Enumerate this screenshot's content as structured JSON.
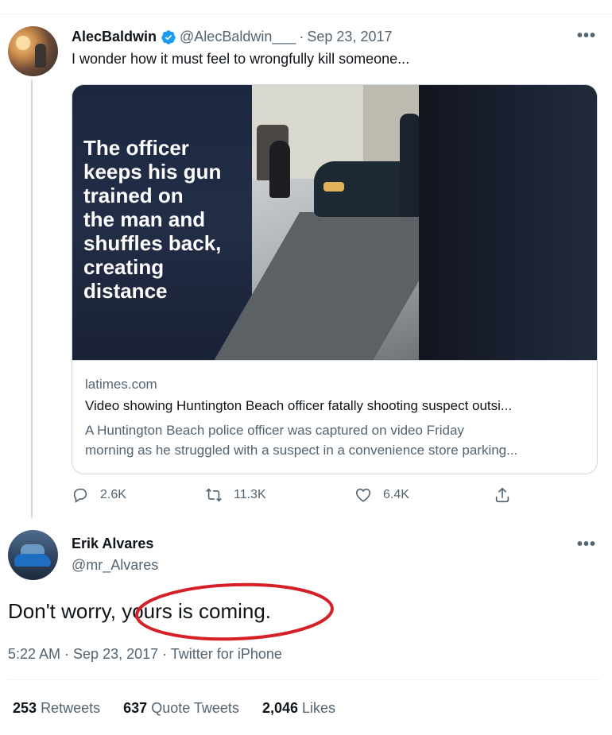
{
  "original_tweet": {
    "display_name": "AlecBaldwin",
    "handle": "@AlecBaldwin___",
    "separator": "·",
    "date": "Sep 23, 2017",
    "more_icon": "•••",
    "text": "I wonder how it must feel to wrongfully kill someone...",
    "card": {
      "overlay_text": "The officer\nkeeps his gun\ntrained on\nthe man and\nshuffles back,\ncreating\ndistance",
      "domain": "latimes.com",
      "title": "Video showing Huntington Beach officer fatally shooting suspect outsi...",
      "description_line1": "A Huntington Beach police officer was captured on video Friday",
      "description_line2": "morning as he struggled with a suspect in a convenience store parking..."
    },
    "actions": {
      "reply_count": "2.6K",
      "retweet_count": "11.3K",
      "like_count": "6.4K"
    }
  },
  "reply_tweet": {
    "display_name": "Erik Alvares",
    "handle": "@mr_Alvares",
    "more_icon": "•••",
    "text_before": "Don't worry, ",
    "text_highlight": "yours is coming.",
    "timestamp": "5:22 AM · Sep 23, 2017 · Twitter for iPhone",
    "stats": {
      "retweets_count": "253",
      "retweets_label": "Retweets",
      "quote_count": "637",
      "quote_label": "Quote Tweets",
      "likes_count": "2,046",
      "likes_label": "Likes"
    }
  },
  "colors": {
    "verified_blue": "#1d9bf0",
    "highlight_circle": "#d61f26",
    "secondary_text": "#536471"
  },
  "icons": [
    "verified-badge-icon",
    "more-icon",
    "reply-icon",
    "retweet-icon",
    "like-icon",
    "share-icon"
  ]
}
